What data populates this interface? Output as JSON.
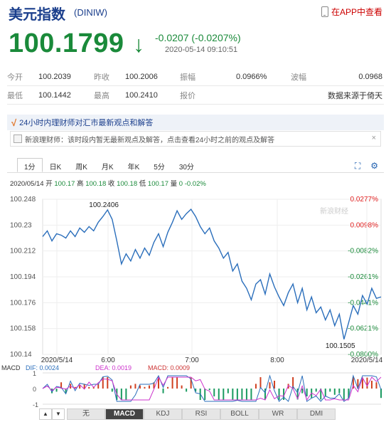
{
  "header": {
    "title": "美元指数",
    "code": "(DINIW)",
    "app_link": "在APP中查看",
    "price": "100.1799",
    "change": "-0.0207 (-0.0207%)",
    "time": "2020-05-14 09:10:51",
    "colors": {
      "down": "#1a8a3a",
      "up": "#e02020",
      "brand": "#1a3e8c"
    }
  },
  "stats": {
    "row1": [
      {
        "label": "今开",
        "value": "100.2039"
      },
      {
        "label": "昨收",
        "value": "100.2006"
      },
      {
        "label": "振幅",
        "value": "0.0966%"
      },
      {
        "label": "波幅",
        "value": "0.0968"
      }
    ],
    "row2": [
      {
        "label": "最低",
        "value": "100.1442"
      },
      {
        "label": "最高",
        "value": "100.2410"
      },
      {
        "label": "报价",
        "value": ""
      },
      {
        "label": "",
        "value": "数据来源于倚天"
      }
    ]
  },
  "notice": {
    "headline": "24小时内理财师对汇市最新观点和解答",
    "message": "新浪理财师：该时段内暂无最新观点及解答，点击查看24小时之前的观点及解答",
    "close": "×"
  },
  "tabs": [
    "1分",
    "日K",
    "周K",
    "月K",
    "年K",
    "5分",
    "30分"
  ],
  "infoline": {
    "date": "2020/05/14",
    "open_label": "开",
    "open": "100.17",
    "high_label": "高",
    "high": "100.18",
    "close_label": "收",
    "close": "100.18",
    "low_label": "低",
    "low": "100.17",
    "vol_label": "量",
    "vol": "0",
    "pct": "-0.02%"
  },
  "bottom_tabs": [
    "无",
    "MACD",
    "KDJ",
    "RSI",
    "BOLL",
    "WR",
    "DMI"
  ],
  "macd_labels": {
    "name": "MACD",
    "dif": "DIF: 0.0024",
    "dea": "DEA: 0.0019",
    "macd": "MACD: 0.0009"
  },
  "watermark": "新浪财经",
  "chart_data": {
    "type": "line",
    "y_ticks": [
      "100.248",
      "100.23",
      "100.212",
      "100.194",
      "100.176",
      "100.158",
      "100.14"
    ],
    "ylim": [
      100.14,
      100.248
    ],
    "pct_ticks": [
      "0.0277%",
      "0.0098%",
      "-0.0082%",
      "-0.0261%",
      "-0.0441%",
      "-0.0621%",
      "-0.0800%"
    ],
    "x_ticks": [
      "2020/5/14",
      "6:00",
      "7:00",
      "8:00",
      "2020/5/14"
    ],
    "annotations": [
      {
        "text": "100.2406",
        "value": 100.2406,
        "index": 14
      },
      {
        "text": "100.1505",
        "value": 100.1505,
        "index": 65
      }
    ],
    "macd_axis": [
      "1",
      "0",
      "-1"
    ],
    "series": {
      "price": [
        100.222,
        100.226,
        100.219,
        100.224,
        100.223,
        100.221,
        100.226,
        100.222,
        100.228,
        100.225,
        100.229,
        100.226,
        100.232,
        100.236,
        100.2406,
        100.234,
        100.219,
        100.203,
        100.21,
        100.205,
        100.213,
        100.207,
        100.214,
        100.209,
        100.218,
        100.224,
        100.215,
        100.225,
        100.232,
        100.24,
        100.234,
        100.238,
        100.241,
        100.236,
        100.229,
        100.224,
        100.228,
        100.219,
        100.214,
        100.207,
        100.211,
        100.198,
        100.203,
        100.191,
        100.186,
        100.178,
        100.189,
        100.192,
        100.182,
        100.196,
        100.187,
        100.18,
        100.174,
        100.183,
        100.189,
        100.176,
        100.186,
        100.171,
        100.18,
        100.169,
        100.173,
        100.164,
        100.171,
        100.16,
        100.168,
        100.1505,
        100.162,
        100.174,
        100.168,
        100.181,
        100.175,
        100.186,
        100.179,
        100.18
      ]
    }
  }
}
